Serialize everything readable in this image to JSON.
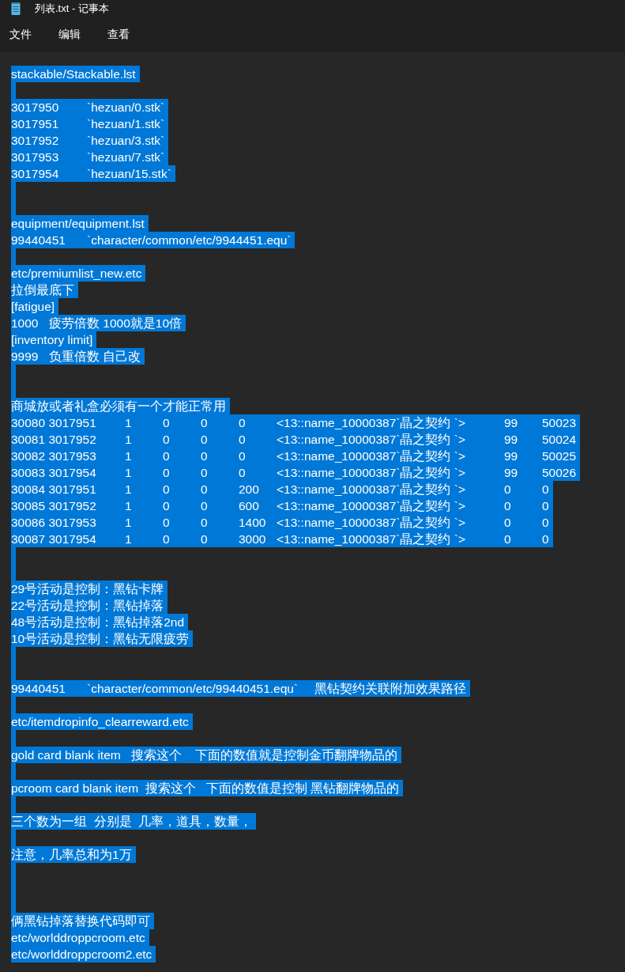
{
  "window": {
    "title": "列表.txt - 记事本"
  },
  "menu": [
    {
      "label": "文件"
    },
    {
      "label": "编辑"
    },
    {
      "label": "查看"
    }
  ],
  "editor": {
    "lines": [
      {
        "kind": "text",
        "text": "stackable/Stackable.lst",
        "selected": true
      },
      {
        "kind": "blank",
        "selected": true
      },
      {
        "kind": "text",
        "text": "3017950\t`hezuan/0.stk`",
        "selected": true
      },
      {
        "kind": "text",
        "text": "3017951\t`hezuan/1.stk`",
        "selected": true
      },
      {
        "kind": "text",
        "text": "3017952\t`hezuan/3.stk`",
        "selected": true
      },
      {
        "kind": "text",
        "text": "3017953\t`hezuan/7.stk`",
        "selected": true
      },
      {
        "kind": "text",
        "text": "3017954\t`hezuan/15.stk`",
        "selected": true
      },
      {
        "kind": "blank",
        "selected": true
      },
      {
        "kind": "blank",
        "selected": true
      },
      {
        "kind": "text",
        "text": "equipment/equipment.lst",
        "selected": true
      },
      {
        "kind": "text",
        "text": "99440451\t`character/common/etc/9944451.equ`",
        "selected": true
      },
      {
        "kind": "blank",
        "selected": true
      },
      {
        "kind": "text",
        "text": "etc/premiumlist_new.etc",
        "selected": true
      },
      {
        "kind": "text",
        "text": "拉倒最底下",
        "selected": true
      },
      {
        "kind": "text",
        "text": "[fatigue]",
        "selected": true
      },
      {
        "kind": "text",
        "text": "1000\t疲劳倍数 1000就是10倍",
        "selected": true
      },
      {
        "kind": "text",
        "text": "[inventory limit]",
        "selected": true
      },
      {
        "kind": "text",
        "text": "9999\t负重倍数 自己改",
        "selected": true
      },
      {
        "kind": "blank",
        "selected": true
      },
      {
        "kind": "blank",
        "selected": true
      },
      {
        "kind": "text",
        "text": "商城放或者礼盒必须有一个才能正常用",
        "selected": true
      },
      {
        "kind": "text",
        "text": "30080 3017951\t1\t0\t0\t0\t<13::name_10000387`晶之契约 `>\t99\t50023",
        "selected": true
      },
      {
        "kind": "text",
        "text": "30081 3017952\t1\t0\t0\t0\t<13::name_10000387`晶之契约 `>\t99\t50024",
        "selected": true
      },
      {
        "kind": "text",
        "text": "30082 3017953\t1\t0\t0\t0\t<13::name_10000387`晶之契约 `>\t99\t50025",
        "selected": true
      },
      {
        "kind": "text",
        "text": "30083 3017954\t1\t0\t0\t0\t<13::name_10000387`晶之契约 `>\t99\t50026",
        "selected": true
      },
      {
        "kind": "text",
        "text": "30084 3017951\t1\t0\t0\t200\t<13::name_10000387`晶之契约 `>\t0\t0",
        "selected": true
      },
      {
        "kind": "text",
        "text": "30085 3017952\t1\t0\t0\t600\t<13::name_10000387`晶之契约 `>\t0\t0",
        "selected": true
      },
      {
        "kind": "text",
        "text": "30086 3017953\t1\t0\t0\t1400\t<13::name_10000387`晶之契约 `>\t0\t0",
        "selected": true
      },
      {
        "kind": "text",
        "text": "30087 3017954\t1\t0\t0\t3000\t<13::name_10000387`晶之契约 `>\t0\t0",
        "selected": true
      },
      {
        "kind": "blank",
        "selected": true
      },
      {
        "kind": "blank",
        "selected": true
      },
      {
        "kind": "text",
        "text": "29号活动是控制：黑钻卡牌",
        "selected": true
      },
      {
        "kind": "text",
        "text": "22号活动是控制：黑钻掉落",
        "selected": true
      },
      {
        "kind": "text",
        "text": "48号活动是控制：黑钻掉落2nd",
        "selected": true
      },
      {
        "kind": "text",
        "text": "10号活动是控制：黑钻无限疲劳",
        "selected": true
      },
      {
        "kind": "blank",
        "selected": true
      },
      {
        "kind": "blank",
        "selected": true
      },
      {
        "kind": "text",
        "text": "99440451\t`character/common/etc/99440451.equ`\t黑钻契约关联附加效果路径",
        "selected": true
      },
      {
        "kind": "blank",
        "selected": true
      },
      {
        "kind": "text",
        "text": "etc/itemdropinfo_clearreward.etc",
        "selected": true
      },
      {
        "kind": "blank",
        "selected": true
      },
      {
        "kind": "text",
        "text": "gold card blank item   搜索这个    下面的数值就是控制金币翻牌物品的",
        "selected": true
      },
      {
        "kind": "blank",
        "selected": true
      },
      {
        "kind": "text",
        "text": "pcroom card blank item  搜索这个   下面的数值是控制 黑钻翻牌物品的",
        "selected": true
      },
      {
        "kind": "blank",
        "selected": true
      },
      {
        "kind": "text",
        "text": "三个数为一组  分别是  几率，道具，数量，",
        "selected": true
      },
      {
        "kind": "blank",
        "selected": true
      },
      {
        "kind": "text",
        "text": "注意，几率总和为1万",
        "selected": true
      },
      {
        "kind": "blank",
        "selected": true
      },
      {
        "kind": "blank",
        "selected": true
      },
      {
        "kind": "blank",
        "selected": true
      },
      {
        "kind": "text",
        "text": "俩黑钻掉落替换代码即可",
        "selected": true
      },
      {
        "kind": "text",
        "text": "etc/worlddroppcroom.etc",
        "selected": true
      },
      {
        "kind": "text",
        "text": "etc/worlddroppcroom2.etc",
        "selected": true
      }
    ]
  }
}
